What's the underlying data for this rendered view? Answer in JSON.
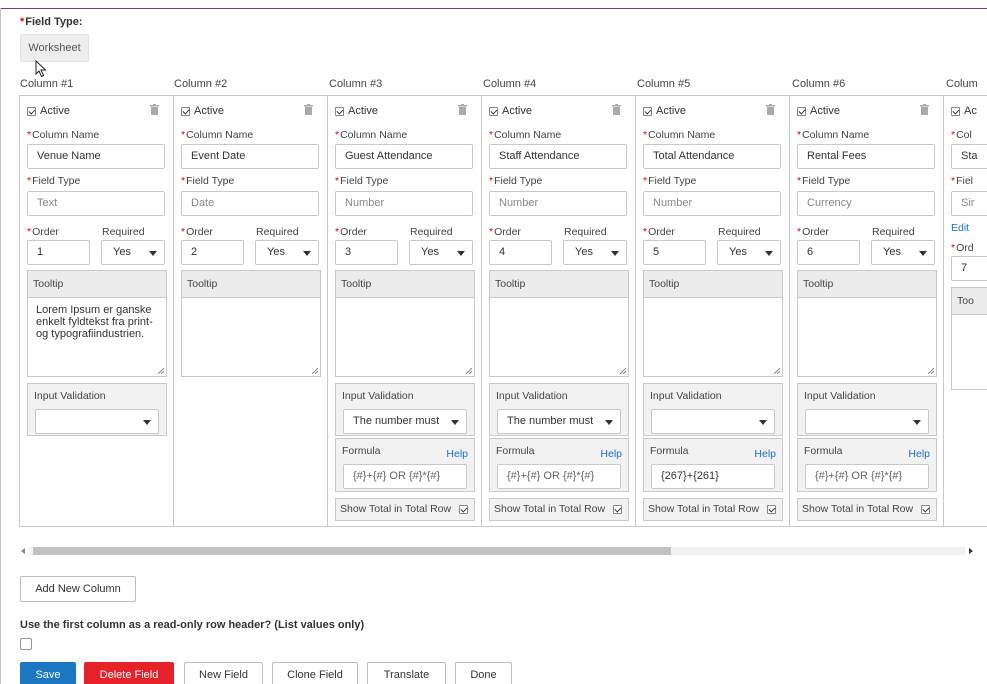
{
  "form": {
    "field_type_label": "Field Type:",
    "field_type_value": "Worksheet",
    "required_marker": "*"
  },
  "columns": [
    {
      "header": "Column #1",
      "active_label": "Active",
      "name_label": "Column Name",
      "name_value": "Venue Name",
      "type_label": "Field Type",
      "type_value": "Text",
      "order_label": "Order",
      "order_value": "1",
      "required_label": "Required",
      "required_value": "Yes",
      "tooltip_label": "Tooltip",
      "tooltip_value": "Lorem Ipsum er ganske enkelt fyldtekst fra print- og typografiindustrien.",
      "validation_label": "Input Validation",
      "validation_value": ""
    },
    {
      "header": "Column #2",
      "active_label": "Active",
      "name_label": "Column Name",
      "name_value": "Event Date",
      "type_label": "Field Type",
      "type_value": "Date",
      "order_label": "Order",
      "order_value": "2",
      "required_label": "Required",
      "required_value": "Yes",
      "tooltip_label": "Tooltip",
      "tooltip_value": ""
    },
    {
      "header": "Column #3",
      "active_label": "Active",
      "name_label": "Column Name",
      "name_value": "Guest Attendance",
      "type_label": "Field Type",
      "type_value": "Number",
      "order_label": "Order",
      "order_value": "3",
      "required_label": "Required",
      "required_value": "Yes",
      "tooltip_label": "Tooltip",
      "tooltip_value": "",
      "validation_label": "Input Validation",
      "validation_value": "The number must",
      "formula_label": "Formula",
      "formula_help": "Help",
      "formula_value": "{#}+{#} OR {#}*{#}",
      "total_label": "Show Total in Total Row"
    },
    {
      "header": "Column #4",
      "active_label": "Active",
      "name_label": "Column Name",
      "name_value": "Staff Attendance",
      "type_label": "Field Type",
      "type_value": "Number",
      "order_label": "Order",
      "order_value": "4",
      "required_label": "Required",
      "required_value": "Yes",
      "tooltip_label": "Tooltip",
      "tooltip_value": "",
      "validation_label": "Input Validation",
      "validation_value": "The number must",
      "formula_label": "Formula",
      "formula_help": "Help",
      "formula_value": "{#}+{#} OR {#}*{#}",
      "total_label": "Show Total in Total Row"
    },
    {
      "header": "Column #5",
      "active_label": "Active",
      "name_label": "Column Name",
      "name_value": "Total Attendance",
      "type_label": "Field Type",
      "type_value": "Number",
      "order_label": "Order",
      "order_value": "5",
      "required_label": "Required",
      "required_value": "Yes",
      "tooltip_label": "Tooltip",
      "tooltip_value": "",
      "validation_label": "Input Validation",
      "validation_value": "",
      "formula_label": "Formula",
      "formula_help": "Help",
      "formula_value": "{267}+{261}",
      "total_label": "Show Total in Total Row"
    },
    {
      "header": "Column #6",
      "active_label": "Active",
      "name_label": "Column Name",
      "name_value": "Rental Fees",
      "type_label": "Field Type",
      "type_value": "Currency",
      "order_label": "Order",
      "order_value": "6",
      "required_label": "Required",
      "required_value": "Yes",
      "tooltip_label": "Tooltip",
      "tooltip_value": "",
      "validation_label": "Input Validation",
      "validation_value": "",
      "formula_label": "Formula",
      "formula_help": "Help",
      "formula_value": "{#}+{#} OR {#}*{#}",
      "total_label": "Show Total in Total Row"
    },
    {
      "header": "Colum",
      "active_label": "Ac",
      "name_label": "Col",
      "name_value": "Sta",
      "type_label": "Fiel",
      "type_value": "Sir",
      "edit_label": "Edit",
      "order_label": "Ord",
      "order_value": "7",
      "tooltip_label": "Too"
    }
  ],
  "scrollbar": {
    "position_fraction": 0.0
  },
  "actions": {
    "add_column": "Add New Column",
    "row_header_question": "Use the first column as a read-only row header? (List values only)",
    "save": "Save",
    "delete": "Delete Field",
    "new_field": "New Field",
    "clone_field": "Clone Field",
    "translate": "Translate",
    "done": "Done"
  },
  "colors": {
    "primary": "#1b76c3",
    "danger": "#e5222a",
    "link": "#1a6fc4",
    "required": "#dd0000"
  }
}
